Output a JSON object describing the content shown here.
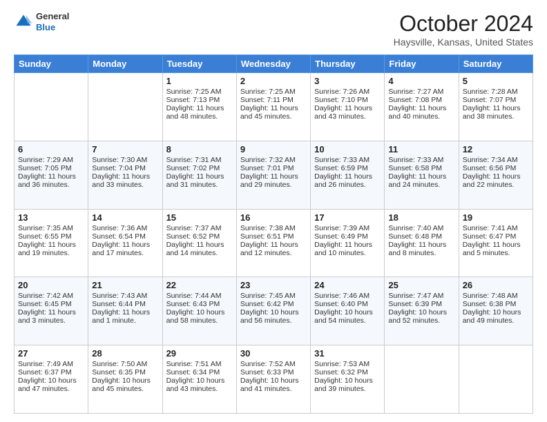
{
  "header": {
    "logo_general": "General",
    "logo_blue": "Blue",
    "title": "October 2024",
    "location": "Haysville, Kansas, United States"
  },
  "days_of_week": [
    "Sunday",
    "Monday",
    "Tuesday",
    "Wednesday",
    "Thursday",
    "Friday",
    "Saturday"
  ],
  "weeks": [
    [
      {
        "day": "",
        "sunrise": "",
        "sunset": "",
        "daylight": ""
      },
      {
        "day": "",
        "sunrise": "",
        "sunset": "",
        "daylight": ""
      },
      {
        "day": "1",
        "sunrise": "Sunrise: 7:25 AM",
        "sunset": "Sunset: 7:13 PM",
        "daylight": "Daylight: 11 hours and 48 minutes."
      },
      {
        "day": "2",
        "sunrise": "Sunrise: 7:25 AM",
        "sunset": "Sunset: 7:11 PM",
        "daylight": "Daylight: 11 hours and 45 minutes."
      },
      {
        "day": "3",
        "sunrise": "Sunrise: 7:26 AM",
        "sunset": "Sunset: 7:10 PM",
        "daylight": "Daylight: 11 hours and 43 minutes."
      },
      {
        "day": "4",
        "sunrise": "Sunrise: 7:27 AM",
        "sunset": "Sunset: 7:08 PM",
        "daylight": "Daylight: 11 hours and 40 minutes."
      },
      {
        "day": "5",
        "sunrise": "Sunrise: 7:28 AM",
        "sunset": "Sunset: 7:07 PM",
        "daylight": "Daylight: 11 hours and 38 minutes."
      }
    ],
    [
      {
        "day": "6",
        "sunrise": "Sunrise: 7:29 AM",
        "sunset": "Sunset: 7:05 PM",
        "daylight": "Daylight: 11 hours and 36 minutes."
      },
      {
        "day": "7",
        "sunrise": "Sunrise: 7:30 AM",
        "sunset": "Sunset: 7:04 PM",
        "daylight": "Daylight: 11 hours and 33 minutes."
      },
      {
        "day": "8",
        "sunrise": "Sunrise: 7:31 AM",
        "sunset": "Sunset: 7:02 PM",
        "daylight": "Daylight: 11 hours and 31 minutes."
      },
      {
        "day": "9",
        "sunrise": "Sunrise: 7:32 AM",
        "sunset": "Sunset: 7:01 PM",
        "daylight": "Daylight: 11 hours and 29 minutes."
      },
      {
        "day": "10",
        "sunrise": "Sunrise: 7:33 AM",
        "sunset": "Sunset: 6:59 PM",
        "daylight": "Daylight: 11 hours and 26 minutes."
      },
      {
        "day": "11",
        "sunrise": "Sunrise: 7:33 AM",
        "sunset": "Sunset: 6:58 PM",
        "daylight": "Daylight: 11 hours and 24 minutes."
      },
      {
        "day": "12",
        "sunrise": "Sunrise: 7:34 AM",
        "sunset": "Sunset: 6:56 PM",
        "daylight": "Daylight: 11 hours and 22 minutes."
      }
    ],
    [
      {
        "day": "13",
        "sunrise": "Sunrise: 7:35 AM",
        "sunset": "Sunset: 6:55 PM",
        "daylight": "Daylight: 11 hours and 19 minutes."
      },
      {
        "day": "14",
        "sunrise": "Sunrise: 7:36 AM",
        "sunset": "Sunset: 6:54 PM",
        "daylight": "Daylight: 11 hours and 17 minutes."
      },
      {
        "day": "15",
        "sunrise": "Sunrise: 7:37 AM",
        "sunset": "Sunset: 6:52 PM",
        "daylight": "Daylight: 11 hours and 14 minutes."
      },
      {
        "day": "16",
        "sunrise": "Sunrise: 7:38 AM",
        "sunset": "Sunset: 6:51 PM",
        "daylight": "Daylight: 11 hours and 12 minutes."
      },
      {
        "day": "17",
        "sunrise": "Sunrise: 7:39 AM",
        "sunset": "Sunset: 6:49 PM",
        "daylight": "Daylight: 11 hours and 10 minutes."
      },
      {
        "day": "18",
        "sunrise": "Sunrise: 7:40 AM",
        "sunset": "Sunset: 6:48 PM",
        "daylight": "Daylight: 11 hours and 8 minutes."
      },
      {
        "day": "19",
        "sunrise": "Sunrise: 7:41 AM",
        "sunset": "Sunset: 6:47 PM",
        "daylight": "Daylight: 11 hours and 5 minutes."
      }
    ],
    [
      {
        "day": "20",
        "sunrise": "Sunrise: 7:42 AM",
        "sunset": "Sunset: 6:45 PM",
        "daylight": "Daylight: 11 hours and 3 minutes."
      },
      {
        "day": "21",
        "sunrise": "Sunrise: 7:43 AM",
        "sunset": "Sunset: 6:44 PM",
        "daylight": "Daylight: 11 hours and 1 minute."
      },
      {
        "day": "22",
        "sunrise": "Sunrise: 7:44 AM",
        "sunset": "Sunset: 6:43 PM",
        "daylight": "Daylight: 10 hours and 58 minutes."
      },
      {
        "day": "23",
        "sunrise": "Sunrise: 7:45 AM",
        "sunset": "Sunset: 6:42 PM",
        "daylight": "Daylight: 10 hours and 56 minutes."
      },
      {
        "day": "24",
        "sunrise": "Sunrise: 7:46 AM",
        "sunset": "Sunset: 6:40 PM",
        "daylight": "Daylight: 10 hours and 54 minutes."
      },
      {
        "day": "25",
        "sunrise": "Sunrise: 7:47 AM",
        "sunset": "Sunset: 6:39 PM",
        "daylight": "Daylight: 10 hours and 52 minutes."
      },
      {
        "day": "26",
        "sunrise": "Sunrise: 7:48 AM",
        "sunset": "Sunset: 6:38 PM",
        "daylight": "Daylight: 10 hours and 49 minutes."
      }
    ],
    [
      {
        "day": "27",
        "sunrise": "Sunrise: 7:49 AM",
        "sunset": "Sunset: 6:37 PM",
        "daylight": "Daylight: 10 hours and 47 minutes."
      },
      {
        "day": "28",
        "sunrise": "Sunrise: 7:50 AM",
        "sunset": "Sunset: 6:35 PM",
        "daylight": "Daylight: 10 hours and 45 minutes."
      },
      {
        "day": "29",
        "sunrise": "Sunrise: 7:51 AM",
        "sunset": "Sunset: 6:34 PM",
        "daylight": "Daylight: 10 hours and 43 minutes."
      },
      {
        "day": "30",
        "sunrise": "Sunrise: 7:52 AM",
        "sunset": "Sunset: 6:33 PM",
        "daylight": "Daylight: 10 hours and 41 minutes."
      },
      {
        "day": "31",
        "sunrise": "Sunrise: 7:53 AM",
        "sunset": "Sunset: 6:32 PM",
        "daylight": "Daylight: 10 hours and 39 minutes."
      },
      {
        "day": "",
        "sunrise": "",
        "sunset": "",
        "daylight": ""
      },
      {
        "day": "",
        "sunrise": "",
        "sunset": "",
        "daylight": ""
      }
    ]
  ]
}
